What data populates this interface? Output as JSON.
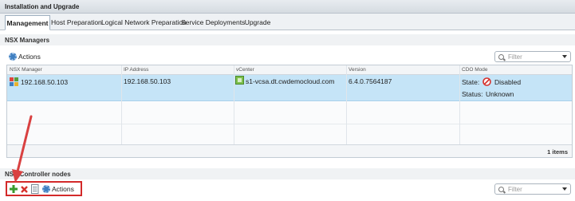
{
  "window": {
    "title": "Installation and Upgrade"
  },
  "tabs": [
    {
      "label": "Management",
      "active": true
    },
    {
      "label": "Host Preparation",
      "active": false
    },
    {
      "label": "Logical Network Preparation",
      "active": false
    },
    {
      "label": "Service Deployments",
      "active": false
    },
    {
      "label": "Upgrade",
      "active": false
    }
  ],
  "managers": {
    "section_title": "NSX Managers",
    "actions_label": "Actions",
    "filter_placeholder": "Filter",
    "columns": [
      "NSX Manager",
      "IP Address",
      "vCenter",
      "Version",
      "CDO Mode"
    ],
    "row": {
      "manager": "192.168.50.103",
      "ip": "192.168.50.103",
      "vcenter": "s1-vcsa.dt.cwdemocloud.com",
      "version": "6.4.0.7564187",
      "state_label": "State:",
      "state_value": "Disabled",
      "status_label": "Status:",
      "status_value": "Unknown"
    },
    "count": "1 items"
  },
  "controllers": {
    "section_title": "NSX Controller nodes",
    "actions_label": "Actions",
    "filter_placeholder": "Filter"
  },
  "colors": {
    "selection": "#c5e4f7",
    "highlight_box": "#d32a2a",
    "arrow": "#d94141"
  },
  "icons": [
    "nsx-manager-icon",
    "vcenter-icon",
    "disabled-icon",
    "gear-icon",
    "search-icon",
    "add-icon",
    "delete-icon",
    "details-icon"
  ]
}
